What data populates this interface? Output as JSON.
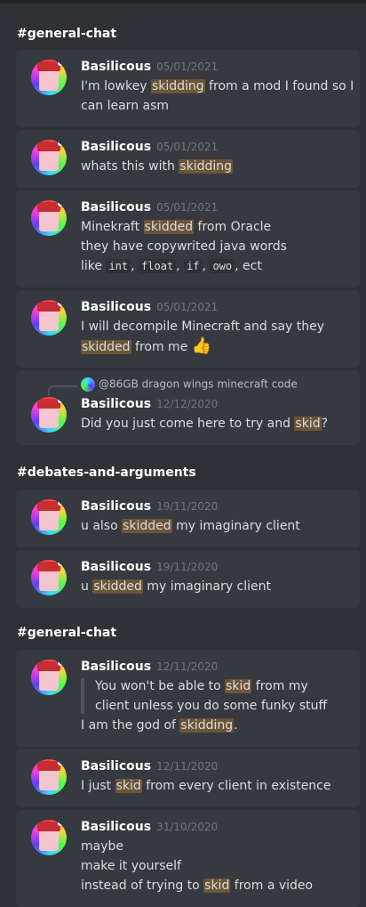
{
  "sections": [
    {
      "channel": "#general-chat",
      "messages": [
        {
          "author": "Basilicous",
          "timestamp": "05/01/2021",
          "lines": [
            [
              "I'm lowkey ",
              {
                "hl": "skidding"
              },
              " from a mod I found so I"
            ],
            [
              "can learn asm"
            ]
          ]
        },
        {
          "author": "Basilicous",
          "timestamp": "05/01/2021",
          "lines": [
            [
              "whats this with ",
              {
                "hl": "skidding"
              }
            ]
          ]
        },
        {
          "author": "Basilicous",
          "timestamp": "05/01/2021",
          "lines": [
            [
              "Minekraft ",
              {
                "hl": "skidded"
              },
              " from Oracle"
            ],
            [
              "they have copywrited java words"
            ],
            [
              "like ",
              {
                "code": "int"
              },
              ", ",
              {
                "code": "float"
              },
              ", ",
              {
                "code": "if"
              },
              ", ",
              {
                "code": "owo"
              },
              ", ect"
            ]
          ]
        },
        {
          "author": "Basilicous",
          "timestamp": "05/01/2021",
          "lines": [
            [
              "I will decompile Minecraft and say they"
            ],
            [
              {
                "hl": "skidded"
              },
              " from me ",
              {
                "emoji": "👍"
              }
            ]
          ]
        },
        {
          "author": "Basilicous",
          "timestamp": "12/12/2020",
          "reply": "@86GB dragon wings minecraft code",
          "lines": [
            [
              "Did you just come here to try and ",
              {
                "hl": "skid"
              },
              "?"
            ]
          ]
        }
      ]
    },
    {
      "channel": "#debates-and-arguments",
      "messages": [
        {
          "author": "Basilicous",
          "timestamp": "19/11/2020",
          "lines": [
            [
              "u also ",
              {
                "hl": "skidded"
              },
              " my imaginary client"
            ]
          ]
        },
        {
          "author": "Basilicous",
          "timestamp": "19/11/2020",
          "lines": [
            [
              "u ",
              {
                "hl": "skidded"
              },
              " my imaginary client"
            ]
          ]
        }
      ]
    },
    {
      "channel": "#general-chat",
      "messages": [
        {
          "author": "Basilicous",
          "timestamp": "12/11/2020",
          "quote": [
            [
              "You won't be able to ",
              {
                "hl": "skid"
              },
              " from my"
            ],
            [
              "client unless you do some funky stuff"
            ]
          ],
          "lines": [
            [
              "I am the god of ",
              {
                "hl": "skidding"
              },
              "."
            ]
          ]
        },
        {
          "author": "Basilicous",
          "timestamp": "12/11/2020",
          "lines": [
            [
              "I just ",
              {
                "hl": "skid"
              },
              " from every client in existence"
            ]
          ]
        },
        {
          "author": "Basilicous",
          "timestamp": "31/10/2020",
          "lines": [
            [
              "maybe"
            ],
            [
              "make it yourself"
            ],
            [
              "instead of trying to ",
              {
                "hl": "skid"
              },
              " from a video"
            ]
          ]
        }
      ]
    }
  ]
}
